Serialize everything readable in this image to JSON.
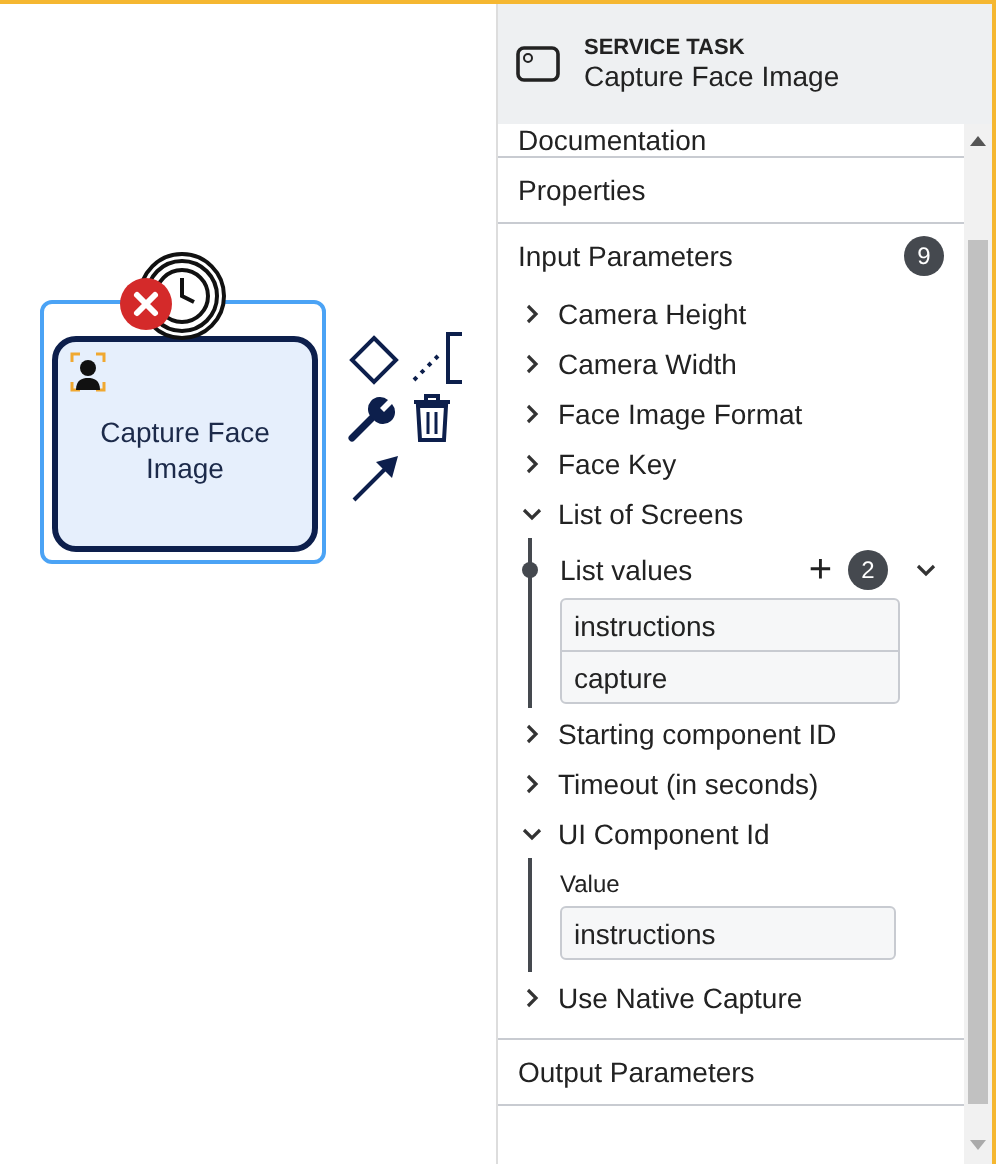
{
  "canvas": {
    "task": {
      "name": "Capture Face Image",
      "selected": true,
      "has_error": true
    }
  },
  "panel": {
    "header": {
      "type": "SERVICE TASK",
      "name": "Capture Face Image"
    },
    "groups": [
      {
        "label": "Documentation"
      },
      {
        "label": "Properties"
      },
      {
        "label": "Input Parameters",
        "count": "9",
        "entries": [
          {
            "label": "Camera Height",
            "expanded": false
          },
          {
            "label": "Camera Width",
            "expanded": false
          },
          {
            "label": "Face Image Format",
            "expanded": false
          },
          {
            "label": "Face Key",
            "expanded": false
          },
          {
            "label": "List of Screens",
            "expanded": true,
            "kind": "list",
            "list": {
              "label": "List values",
              "add": "+",
              "count": "2",
              "items": [
                "instructions",
                "capture"
              ]
            }
          },
          {
            "label": "Starting component ID",
            "expanded": false
          },
          {
            "label": "Timeout (in seconds)",
            "expanded": false
          },
          {
            "label": "UI Component Id",
            "expanded": true,
            "kind": "value",
            "field": {
              "label": "Value",
              "value": "instructions"
            }
          },
          {
            "label": "Use Native Capture",
            "expanded": false
          }
        ]
      },
      {
        "label": "Output Parameters"
      }
    ]
  }
}
